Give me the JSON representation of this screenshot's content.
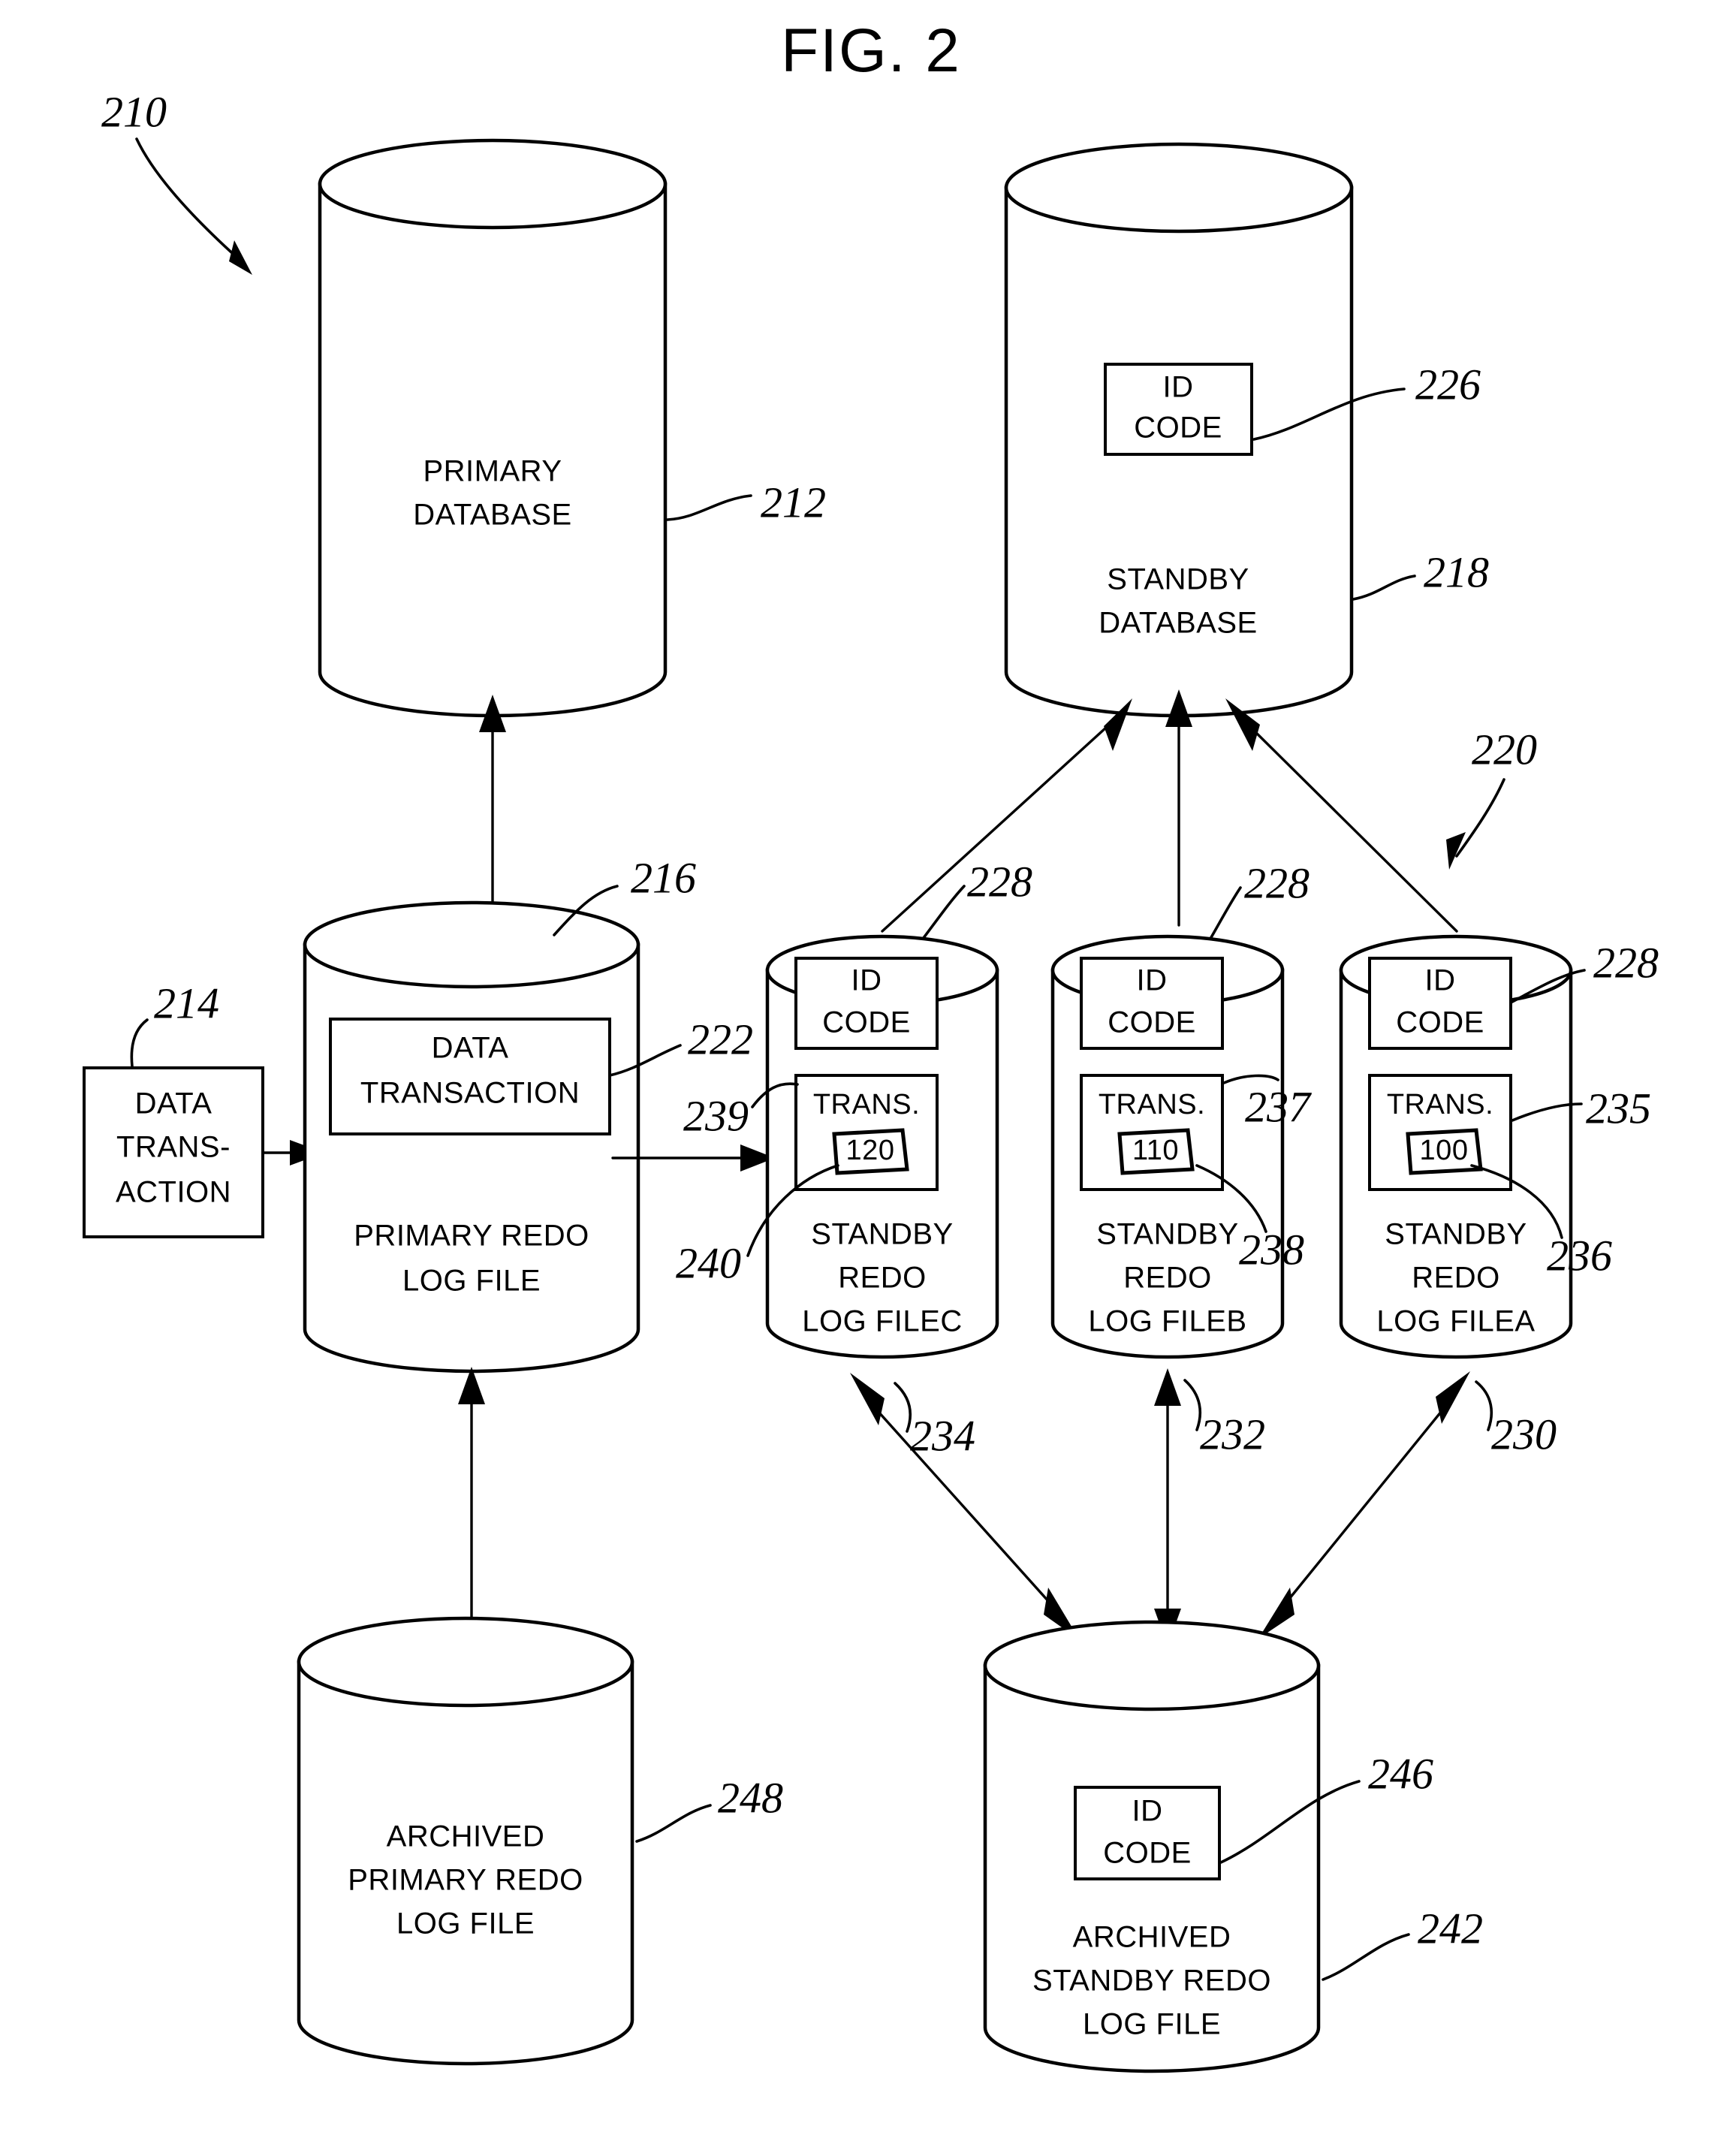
{
  "figure": {
    "title": "FIG. 2",
    "system_ref": "210"
  },
  "nodes": {
    "primary_database": {
      "label_line1": "PRIMARY",
      "label_line2": "DATABASE",
      "ref": "212"
    },
    "standby_database": {
      "label_line1": "STANDBY",
      "label_line2": "DATABASE",
      "ref": "218",
      "id_code_line1": "ID",
      "id_code_line2": "CODE",
      "id_code_ref": "226"
    },
    "data_transaction_input": {
      "label_line1": "DATA",
      "label_line2": "TRANS-",
      "label_line3": "ACTION",
      "ref": "214"
    },
    "primary_redo_log": {
      "label_line1": "PRIMARY REDO",
      "label_line2": "LOG  FILE",
      "ref": "216",
      "inner_box_line1": "DATA",
      "inner_box_line2": "TRANSACTION",
      "inner_box_ref": "222"
    },
    "standby_redo_log_c": {
      "label_line1": "STANDBY",
      "label_line2": "REDO",
      "label_line3": "LOG FILEC",
      "id_code_line1": "ID",
      "id_code_line2": "CODE",
      "id_code_ref": "228",
      "trans_label": "TRANS.",
      "trans_value": "120",
      "trans_box_ref": "239",
      "trans_value_ref": "240"
    },
    "standby_redo_log_b": {
      "label_line1": "STANDBY",
      "label_line2": "REDO",
      "label_line3": "LOG FILEB",
      "id_code_line1": "ID",
      "id_code_line2": "CODE",
      "id_code_ref": "228",
      "trans_label": "TRANS.",
      "trans_value": "110",
      "trans_box_ref": "237",
      "trans_value_ref": "238"
    },
    "standby_redo_log_a": {
      "label_line1": "STANDBY",
      "label_line2": "REDO",
      "label_line3": "LOG FILEA",
      "id_code_line1": "ID",
      "id_code_line2": "CODE",
      "id_code_ref": "228",
      "trans_label": "TRANS.",
      "trans_value": "100",
      "trans_box_ref": "235",
      "trans_value_ref": "236"
    },
    "archived_primary_redo_log": {
      "label_line1": "ARCHIVED",
      "label_line2": "PRIMARY REDO",
      "label_line3": "LOG FILE",
      "ref": "248"
    },
    "archived_standby_redo_log": {
      "label_line1": "ARCHIVED",
      "label_line2": "STANDBY REDO",
      "label_line3": "LOG FILE",
      "ref": "242",
      "id_code_line1": "ID",
      "id_code_line2": "CODE",
      "id_code_ref": "246"
    }
  },
  "connections": {
    "standby_group_ref": "220",
    "arrow_c_to_archive_ref": "234",
    "arrow_b_to_archive_ref": "232",
    "arrow_a_to_archive_ref": "230"
  }
}
